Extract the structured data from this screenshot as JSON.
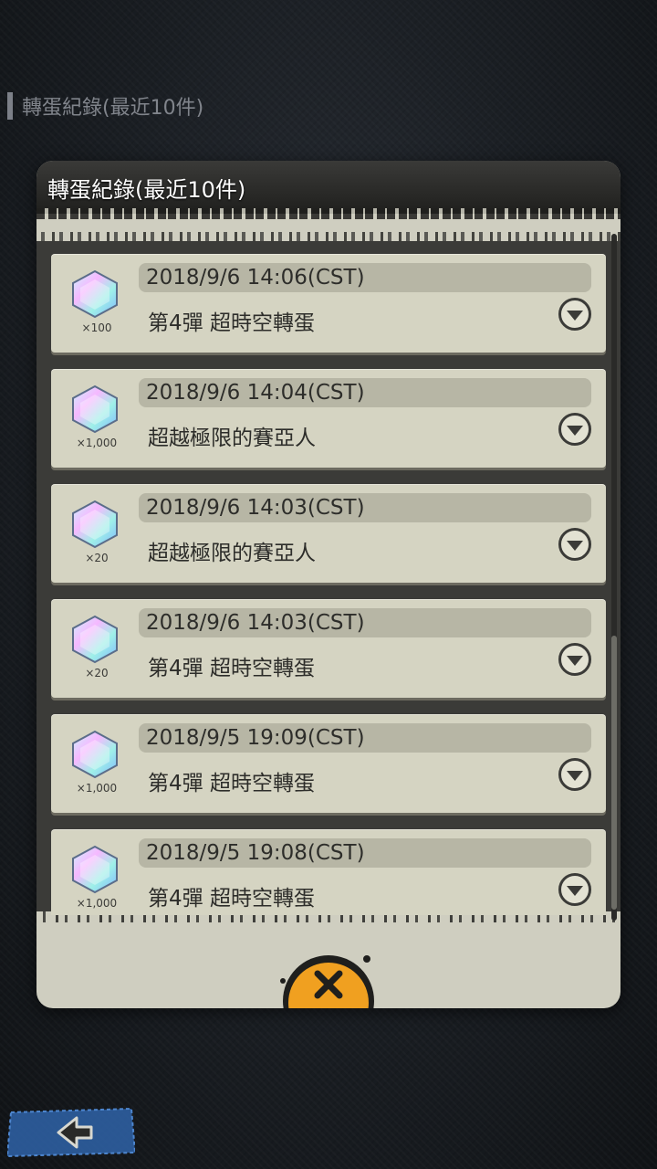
{
  "background_header": {
    "title": "轉蛋紀錄(最近10件)"
  },
  "dialog": {
    "title": "轉蛋紀錄(最近10件)",
    "records": [
      {
        "date": "2018/9/6 14:06(CST)",
        "name": "第4彈 超時空轉蛋",
        "gem_count": "×100"
      },
      {
        "date": "2018/9/6 14:04(CST)",
        "name": "超越極限的賽亞人",
        "gem_count": "×1,000"
      },
      {
        "date": "2018/9/6 14:03(CST)",
        "name": "超越極限的賽亞人",
        "gem_count": "×20"
      },
      {
        "date": "2018/9/6 14:03(CST)",
        "name": "第4彈 超時空轉蛋",
        "gem_count": "×20"
      },
      {
        "date": "2018/9/5 19:09(CST)",
        "name": "第4彈 超時空轉蛋",
        "gem_count": "×1,000"
      },
      {
        "date": "2018/9/5 19:08(CST)",
        "name": "第4彈 超時空轉蛋",
        "gem_count": "×1,000"
      }
    ]
  },
  "colors": {
    "panel": "#cfcec0",
    "header": "#2a2a28",
    "close_button": "#f0a020",
    "back_button": "#2f63a8"
  },
  "icons": {
    "gem": "dragon-stone-icon",
    "expand": "chevron-down-icon",
    "close": "close-icon",
    "back": "back-arrow-icon"
  }
}
